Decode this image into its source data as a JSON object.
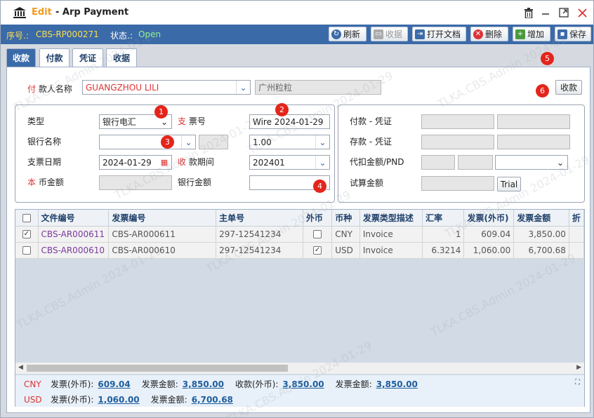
{
  "window": {
    "mode": "Edit",
    "title": "- Arp Payment"
  },
  "infobar": {
    "serial_label": "序号.:",
    "serial_value": "CBS-RP000271",
    "status_label": "状态.:",
    "status_value": "Open"
  },
  "toolbar": {
    "refresh": "刷新",
    "collect": "收据",
    "open_doc": "打开文档",
    "delete": "删除",
    "add": "增加",
    "save": "保存"
  },
  "tabs": [
    "收款",
    "付款",
    "凭证",
    "收据"
  ],
  "payer": {
    "label_red": "付",
    "label": "款人名称",
    "value": "GUANGZHOU LILI",
    "alias": "广州粒粒",
    "collect_button": "收款"
  },
  "left_form": {
    "type_label": "类型",
    "type_value": "银行电汇",
    "bank_label": "银行名称",
    "bank_value": "",
    "date_label": "支票日期",
    "date_value": "2024-01-29",
    "local_label_red": "本",
    "local_label": "币金额",
    "local_value": "",
    "check_label_red": "支",
    "check_label": "票号",
    "check_value": "Wire 2024-01-29",
    "rate_value": "1.00",
    "period_label_red": "收",
    "period_label": "款期间",
    "period_value": "202401",
    "bank_amount_label": "银行金额",
    "bank_amount_value": ""
  },
  "right_form": {
    "pay_voucher": "付款 - 凭证",
    "deposit_voucher": "存款 - 凭证",
    "withhold": "代扣金额/PND",
    "trial_amount": "试算金额",
    "trial_button": "Trial"
  },
  "badges": [
    "1",
    "2",
    "3",
    "4",
    "5",
    "6"
  ],
  "grid": {
    "columns": [
      "文件编号",
      "发票编号",
      "主单号",
      "外币",
      "币种",
      "发票类型描述",
      "汇率",
      "发票(外币)",
      "发票金额",
      "折"
    ],
    "rows": [
      {
        "checked": "✓",
        "doc": "CBS-AR000611",
        "invoice": "CBS-AR000611",
        "master": "297-12541234",
        "fx": "",
        "cur": "CNY",
        "desc": "Invoice",
        "rate": "1",
        "inv_fx": "609.04",
        "amount": "3,850.00"
      },
      {
        "checked": "",
        "doc": "CBS-AR000610",
        "invoice": "CBS-AR000610",
        "master": "297-12541234",
        "fx": "✓",
        "cur": "USD",
        "desc": "Invoice",
        "rate": "6.3214",
        "inv_fx": "1,060.00",
        "amount": "6,700.68"
      }
    ]
  },
  "footer": {
    "rows": [
      {
        "cur": "CNY",
        "l1": "发票(外币):",
        "v1": "609.04",
        "l2": "发票金额:",
        "v2": "3,850.00",
        "l3": "收款(外币):",
        "v3": "3,850.00",
        "l4": "发票金额:",
        "v4": "3,850.00"
      },
      {
        "cur": "USD",
        "l1": "发票(外币):",
        "v1": "1,060.00",
        "l2": "发票金额:",
        "v2": "6,700.68"
      }
    ]
  },
  "watermark": "TLKA.CBS.Admin 2024-01-29"
}
